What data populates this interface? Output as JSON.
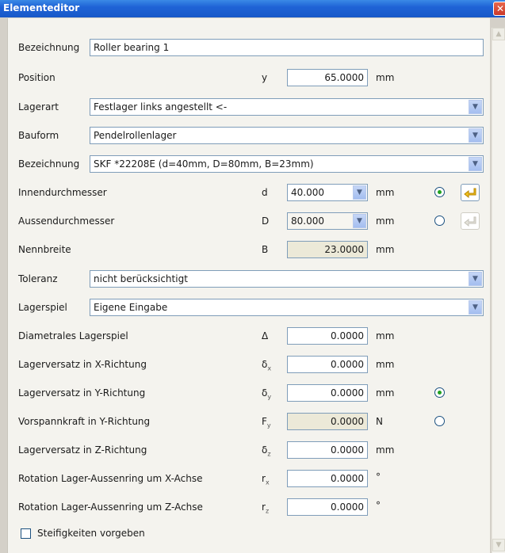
{
  "window": {
    "title": "Elementeditor",
    "close_glyph": "✕"
  },
  "rows": {
    "bezeichnung": {
      "label": "Bezeichnung",
      "value": "Roller bearing 1"
    },
    "position": {
      "label": "Position",
      "symbol": "y",
      "value": "65.0000",
      "unit": "mm"
    },
    "lagerart": {
      "label": "Lagerart",
      "value": "Festlager links angestellt <-"
    },
    "bauform": {
      "label": "Bauform",
      "value": "Pendelrollenlager"
    },
    "bezeichnung2": {
      "label": "Bezeichnung",
      "value": "SKF *22208E (d=40mm, D=80mm, B=23mm)"
    },
    "innendurchmesser": {
      "label": "Innendurchmesser",
      "symbol": "d",
      "value": "40.000",
      "unit": "mm",
      "radio_selected": true
    },
    "aussendurchmesser": {
      "label": "Aussendurchmesser",
      "symbol": "D",
      "value": "80.000",
      "unit": "mm",
      "radio_selected": false
    },
    "nennbreite": {
      "label": "Nennbreite",
      "symbol": "B",
      "value": "23.0000",
      "unit": "mm"
    },
    "toleranz": {
      "label": "Toleranz",
      "value": "nicht berücksichtigt"
    },
    "lagerspiel": {
      "label": "Lagerspiel",
      "value": "Eigene Eingabe"
    },
    "diametrales": {
      "label": "Diametrales Lagerspiel",
      "symbol": "Δ",
      "value": "0.0000",
      "unit": "mm"
    },
    "versatz_x": {
      "label": "Lagerversatz in X-Richtung",
      "symbol": "δ",
      "sub": "x",
      "value": "0.0000",
      "unit": "mm"
    },
    "versatz_y": {
      "label": "Lagerversatz in Y-Richtung",
      "symbol": "δ",
      "sub": "y",
      "value": "0.0000",
      "unit": "mm",
      "radio_selected": true
    },
    "vorspann_y": {
      "label": "Vorspannkraft in Y-Richtung",
      "symbol": "F",
      "sub": "y",
      "value": "0.0000",
      "unit": "N",
      "radio_selected": false
    },
    "versatz_z": {
      "label": "Lagerversatz in Z-Richtung",
      "symbol": "δ",
      "sub": "z",
      "value": "0.0000",
      "unit": "mm"
    },
    "rotation_x": {
      "label": "Rotation Lager-Aussenring um X-Achse",
      "symbol": "r",
      "sub": "x",
      "value": "0.0000",
      "unit": "°"
    },
    "rotation_z": {
      "label": "Rotation Lager-Aussenring um Z-Achse",
      "symbol": "r",
      "sub": "z",
      "value": "0.0000",
      "unit": "°"
    }
  },
  "steifigkeiten": {
    "label": "Steifigkeiten vorgeben",
    "checked": false
  },
  "icons": {
    "dropdown_arrow": "chevron-down-icon",
    "transfer": "yellow-arrow-icon",
    "scroll_up": "scroll-up-icon",
    "scroll_down": "scroll-down-icon"
  },
  "colors": {
    "titlebar": "#1f63d6",
    "panel": "#f4f3ee",
    "field_border": "#7f9db9",
    "radio_dot": "#21a121",
    "readonly_field": "#ece9d8"
  }
}
